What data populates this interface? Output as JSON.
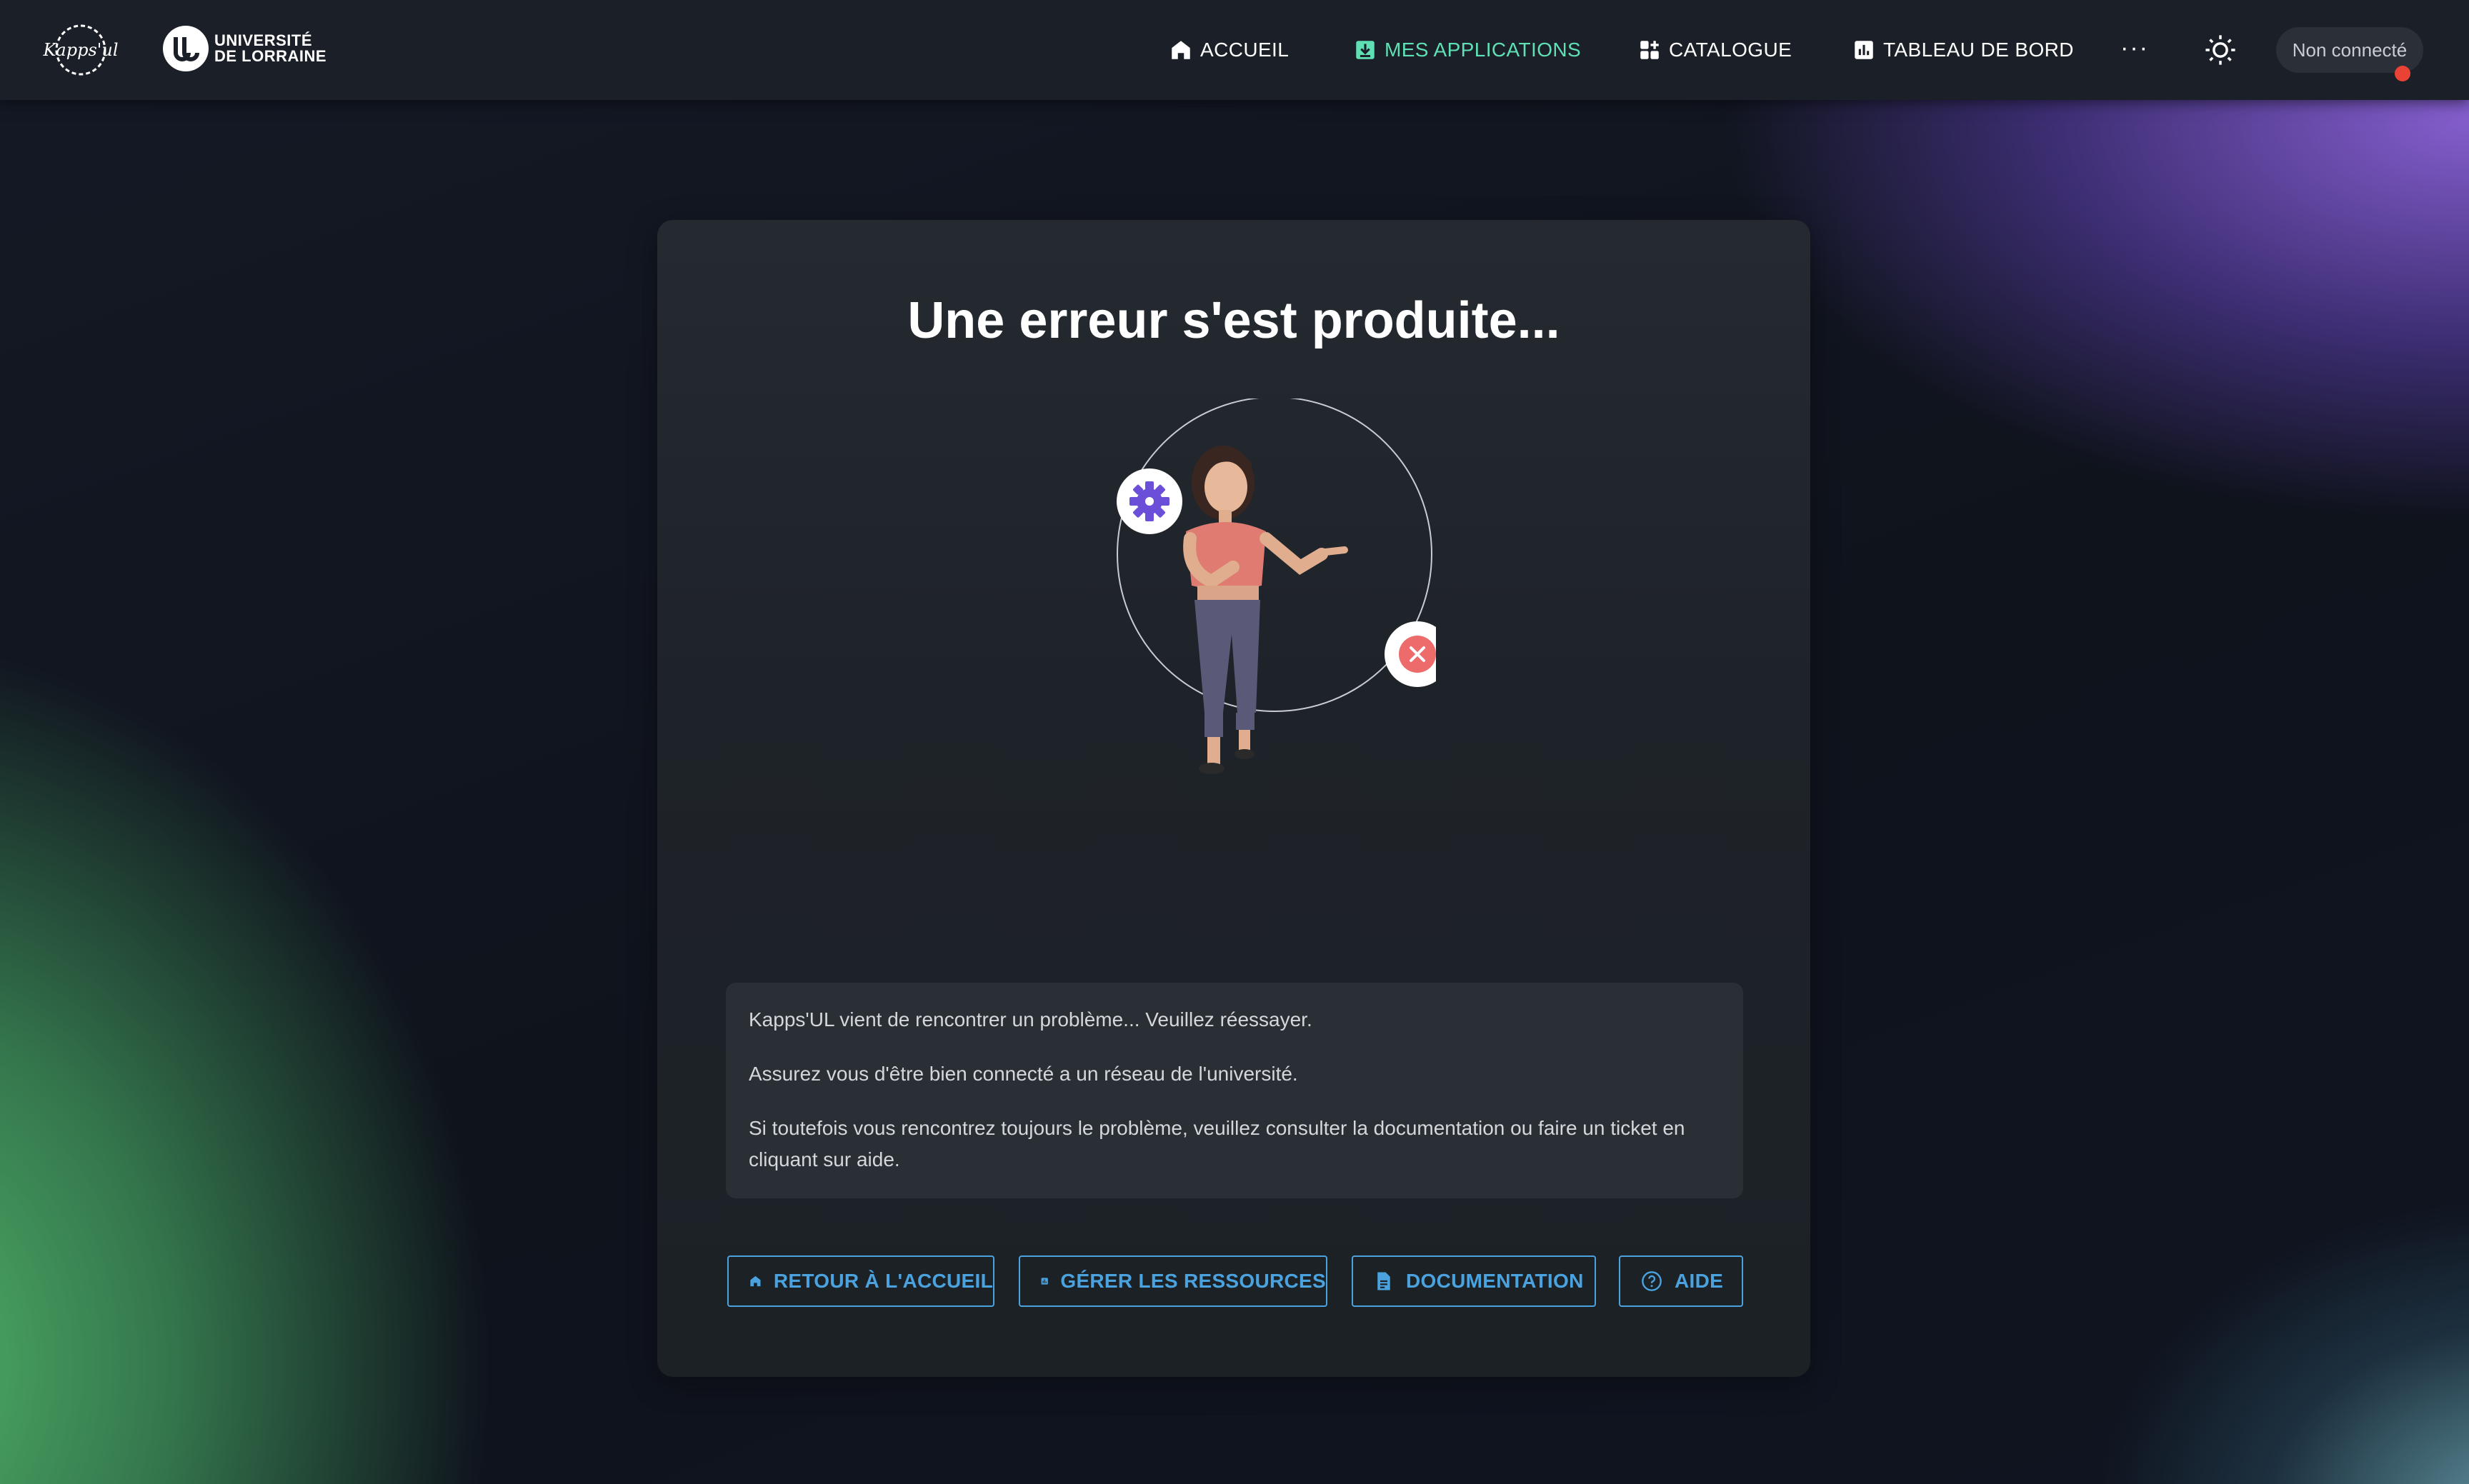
{
  "nav": {
    "logo_text": "Kapps'UL",
    "university_line1": "UNIVERSITÉ",
    "university_line2": "DE LORRAINE",
    "items": [
      {
        "label": "ACCUEIL",
        "icon": "home-icon",
        "active": false
      },
      {
        "label": "MES APPLICATIONS",
        "icon": "download-box-icon",
        "active": true
      },
      {
        "label": "CATALOGUE",
        "icon": "apps-plus-icon",
        "active": false
      },
      {
        "label": "TABLEAU DE BORD",
        "icon": "bar-chart-icon",
        "active": false
      }
    ],
    "more_label": "···",
    "theme_icon": "sun-icon",
    "user_status": "Non connecté",
    "status_color": "#ea4335",
    "active_color": "#5ee0b4"
  },
  "error": {
    "title": "Une erreur s'est produite...",
    "messages": [
      "Kapps'UL vient de rencontrer un problème... Veuillez réessayer.",
      "Assurez vous d'être bien connecté a un réseau de l'université.",
      "Si toutefois vous rencontrez toujours le problème, veuillez consulter la documentation ou faire un ticket en cliquant sur aide."
    ]
  },
  "actions": [
    {
      "label": "RETOUR À L'ACCUEIL",
      "icon": "home-icon"
    },
    {
      "label": "GÉRER LES RESSOURCES",
      "icon": "bar-chart-icon"
    },
    {
      "label": "DOCUMENTATION",
      "icon": "document-icon"
    },
    {
      "label": "AIDE",
      "icon": "help-circle-icon"
    }
  ],
  "accent_color": "#4aa3df"
}
